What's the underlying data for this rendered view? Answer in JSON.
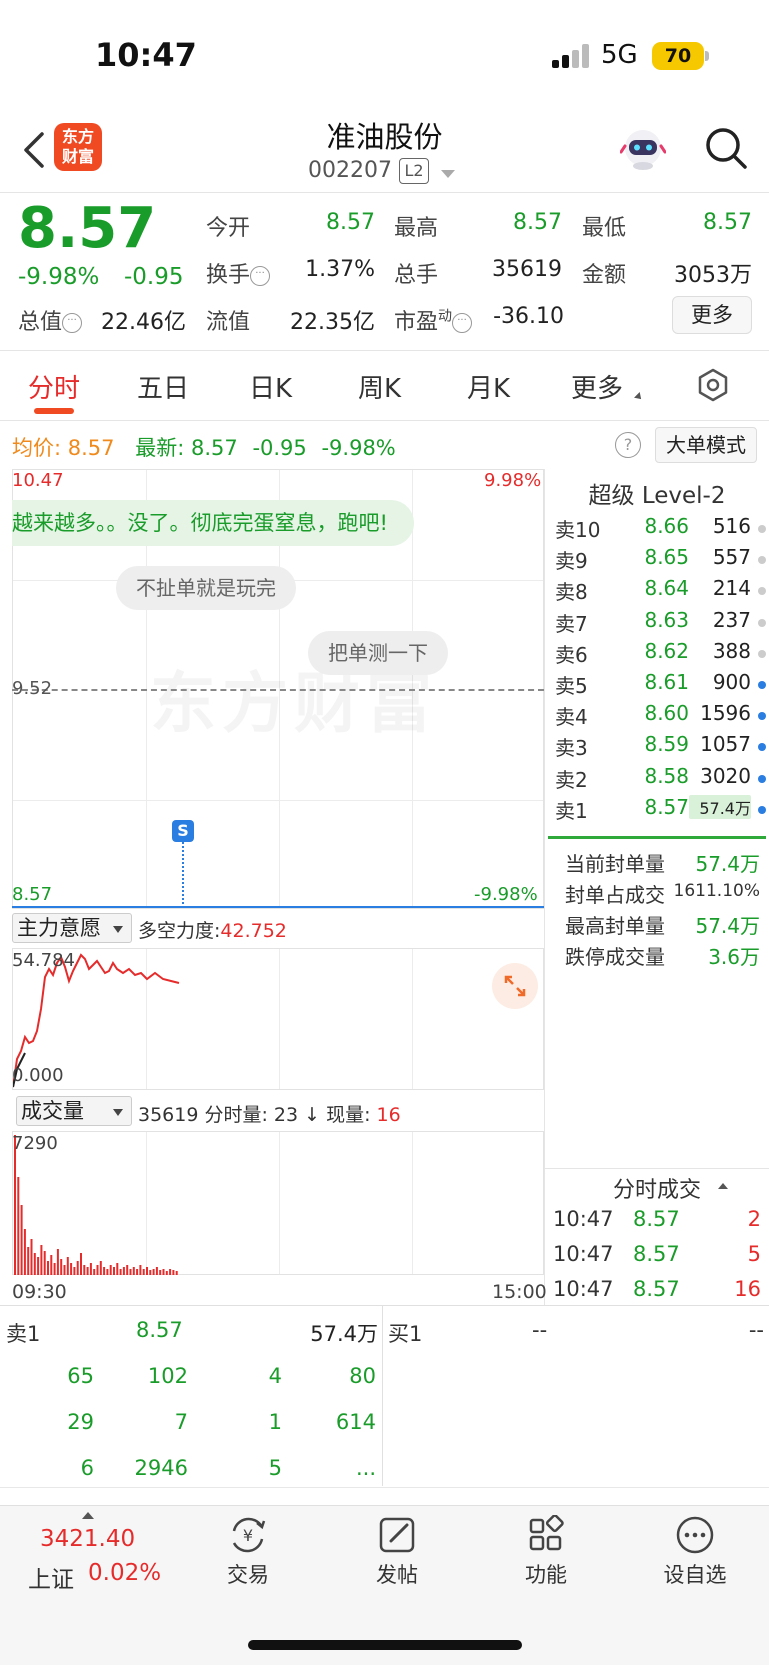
{
  "status": {
    "time": "10:47",
    "network": "5G",
    "battery": "70"
  },
  "header": {
    "logo_line1": "东方",
    "logo_line2": "财富",
    "name": "准油股份",
    "code": "002207",
    "level_badge": "L2"
  },
  "quote": {
    "price": "8.57",
    "change_pct": "-9.98%",
    "change_abs": "-0.95",
    "open_label": "今开",
    "open": "8.57",
    "high_label": "最高",
    "high": "8.57",
    "low_label": "最低",
    "low": "8.57",
    "turnover_label": "换手",
    "turnover": "1.37%",
    "volume_label": "总手",
    "volume": "35619",
    "amount_label": "金额",
    "amount": "3053万",
    "mktcap_label": "总值",
    "mktcap": "22.46亿",
    "float_label": "流值",
    "float_cap": "22.35亿",
    "pe_label": "市盈",
    "pe_sup": "动",
    "pe": "-36.10",
    "more_label": "更多"
  },
  "tabs": [
    "分时",
    "五日",
    "日K",
    "周K",
    "月K",
    "更多"
  ],
  "avg_row": {
    "avg_label": "均价:",
    "avg": "8.57",
    "latest_label": "最新:",
    "latest": "8.57",
    "chg": "-0.95",
    "pct": "-9.98%",
    "help": "?",
    "big_order_btn": "大单模式"
  },
  "main_chart": {
    "y_high": "10.47",
    "y_mid": "9.52",
    "y_low": "8.57",
    "pct_high": "9.98%",
    "pct_low": "-9.98%",
    "watermark": "东方财富",
    "danmu": [
      "越来越多。。没了。彻底完蛋窒息，跑吧!",
      "不扯单就是玩完",
      "把单测一下"
    ],
    "marker": "S"
  },
  "level2": {
    "title": "超级 Level-2",
    "asks": [
      {
        "label": "卖10",
        "price": "8.66",
        "vol": "516",
        "dot": "#cccccc"
      },
      {
        "label": "卖9",
        "price": "8.65",
        "vol": "557",
        "dot": "#cccccc"
      },
      {
        "label": "卖8",
        "price": "8.64",
        "vol": "214",
        "dot": "#cccccc"
      },
      {
        "label": "卖7",
        "price": "8.63",
        "vol": "237",
        "dot": "#cccccc"
      },
      {
        "label": "卖6",
        "price": "8.62",
        "vol": "388",
        "dot": "#cccccc"
      },
      {
        "label": "卖5",
        "price": "8.61",
        "vol": "900",
        "dot": "#2a7de1"
      },
      {
        "label": "卖4",
        "price": "8.60",
        "vol": "1596",
        "dot": "#2a7de1"
      },
      {
        "label": "卖3",
        "price": "8.59",
        "vol": "1057",
        "dot": "#2a7de1"
      },
      {
        "label": "卖2",
        "price": "8.58",
        "vol": "3020",
        "dot": "#2a7de1"
      },
      {
        "label": "卖1",
        "price": "8.57",
        "vol": "57.4万",
        "dot": "#2a7de1"
      }
    ],
    "seal": [
      {
        "label": "当前封单量",
        "value": "57.4万"
      },
      {
        "label": "封单占成交",
        "value": "1611.10%"
      },
      {
        "label": "最高封单量",
        "value": "57.4万"
      },
      {
        "label": "跌停成交量",
        "value": "3.6万"
      }
    ]
  },
  "indicator": {
    "name": "主力意愿",
    "label_prefix": "多空力度:",
    "value": "42.752",
    "max": "54.784",
    "min": "0.000"
  },
  "volume_panel": {
    "name": "成交量",
    "info": "35619 分时量: 23 ↓ 现量:",
    "current": "16",
    "max": "7290",
    "time_start": "09:30",
    "time_end": "15:00"
  },
  "time_sales": {
    "title": "分时成交",
    "rows": [
      {
        "time": "10:47",
        "price": "8.57",
        "vol": "2"
      },
      {
        "time": "10:47",
        "price": "8.57",
        "vol": "5"
      },
      {
        "time": "10:47",
        "price": "8.57",
        "vol": "16"
      }
    ]
  },
  "queue": {
    "sell_label": "卖1",
    "sell_price": "8.57",
    "sell_vol": "57.4万",
    "buy_label": "买1",
    "buy_price": "--",
    "buy_vol": "--",
    "cells": [
      [
        "65",
        "102",
        "4",
        "80"
      ],
      [
        "29",
        "7",
        "1",
        "614"
      ],
      [
        "6",
        "2946",
        "5",
        "..."
      ]
    ]
  },
  "bottom": {
    "index_value": "3421.40",
    "index_name": "上证",
    "index_pct": "0.02%",
    "nav": [
      "交易",
      "发帖",
      "功能",
      "设自选"
    ]
  }
}
